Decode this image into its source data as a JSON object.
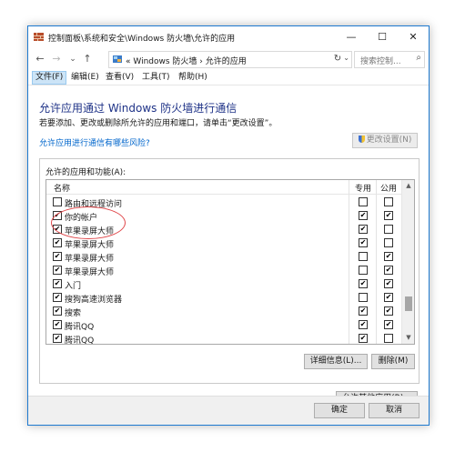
{
  "window": {
    "title": "控制面板\\系统和安全\\Windows 防火墙\\允许的应用",
    "minimize_glyph": "—",
    "maximize_glyph": "☐",
    "close_glyph": "✕"
  },
  "nav": {
    "back": "←",
    "forward": "→",
    "recent": "⌄",
    "up": "↑",
    "address": "« Windows 防火墙 › 允许的应用",
    "refresh": "↻",
    "search_placeholder": "搜索控制...",
    "search_icon": "search-icon"
  },
  "menu": [
    "文件(F)",
    "编辑(E)",
    "查看(V)",
    "工具(T)",
    "帮助(H)"
  ],
  "heading": "允许应用通过 Windows 防火墙进行通信",
  "subtext": "若要添加、更改或删除所允许的应用和端口，请单击“更改设置”。",
  "risk_link": "允许应用进行通信有哪些风险?",
  "change_settings": "更改设置(N)",
  "group_label": "允许的应用和功能(A):",
  "columns": {
    "name": "名称",
    "private": "专用",
    "public": "公用"
  },
  "apps": [
    {
      "name": "路由和远程访问",
      "enabled": false,
      "private": false,
      "public": false
    },
    {
      "name": "你的帐户",
      "enabled": true,
      "private": true,
      "public": true
    },
    {
      "name": "苹果录屏大师",
      "enabled": true,
      "private": true,
      "public": false
    },
    {
      "name": "苹果录屏大师",
      "enabled": true,
      "private": true,
      "public": false
    },
    {
      "name": "苹果录屏大师",
      "enabled": true,
      "private": false,
      "public": true
    },
    {
      "name": "苹果录屏大师",
      "enabled": true,
      "private": false,
      "public": true
    },
    {
      "name": "入门",
      "enabled": true,
      "private": true,
      "public": true
    },
    {
      "name": "搜狗高速浏览器",
      "enabled": true,
      "private": false,
      "public": true
    },
    {
      "name": "搜索",
      "enabled": true,
      "private": true,
      "public": true
    },
    {
      "name": "腾讯QQ",
      "enabled": true,
      "private": true,
      "public": true
    },
    {
      "name": "腾讯QQ",
      "enabled": true,
      "private": true,
      "public": false
    }
  ],
  "buttons": {
    "details": "详细信息(L)...",
    "remove": "删除(M)",
    "allow_other": "允许其他应用(R)...",
    "ok": "确定",
    "cancel": "取消"
  },
  "colors": {
    "heading": "#1e3287",
    "link": "#0066cc",
    "highlight_circle": "#e0484b",
    "menu_active": "#cce4f7"
  }
}
